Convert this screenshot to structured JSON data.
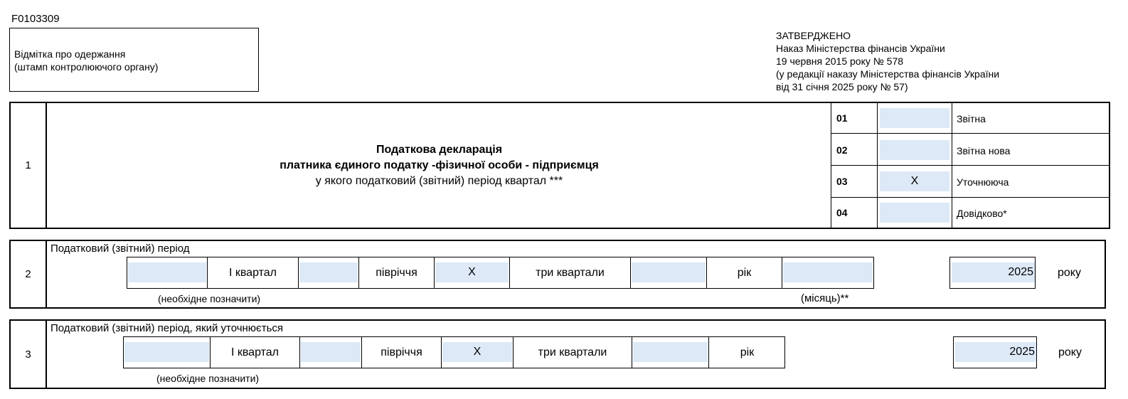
{
  "form_code": "F0103309",
  "stamp": {
    "line1": "Відмітка про одержання",
    "line2": "(штамп контролюючого органу)"
  },
  "approval": {
    "line1": "ЗАТВЕРДЖЕНО",
    "line2": "Наказ Міністерства фінансів України",
    "line3": "19 червня 2015 року № 578",
    "line4": "(у редакції наказу Міністерства фінансів України",
    "line5": "від 31 січня 2025 року № 57)"
  },
  "section1": {
    "number": "1",
    "title1": "Податкова декларація",
    "title2": "платника єдиного податку -фізичної особи - підприємця",
    "title3": "у якого податковий (звітний) період квартал ***",
    "types": [
      {
        "code": "01",
        "mark": "",
        "label": "Звітна"
      },
      {
        "code": "02",
        "mark": "",
        "label": "Звітна нова"
      },
      {
        "code": "03",
        "mark": "X",
        "label": "Уточнююча"
      },
      {
        "code": "04",
        "mark": "",
        "label": "Довідково*"
      }
    ]
  },
  "section2": {
    "number": "2",
    "heading": "Податковий (звітний) період",
    "q1_mark": "",
    "q1_label": "І квартал",
    "half_mark": "",
    "half_label": "півріччя",
    "three_q_mark": "X",
    "three_q_label": "три квартали",
    "year_mark": "",
    "year_label": "рік",
    "month_value": "",
    "year_value": "2025",
    "year_suffix": "року",
    "note_required": "(необхідне позначити)",
    "note_month": "(місяць)**"
  },
  "section3": {
    "number": "3",
    "heading": "Податковий (звітний) період, який уточнюється",
    "q1_mark": "",
    "q1_label": "І квартал",
    "half_mark": "",
    "half_label": "півріччя",
    "three_q_mark": "X",
    "three_q_label": "три квартали",
    "year_mark": "",
    "year_label": "рік",
    "year_value": "2025",
    "year_suffix": "року",
    "note_required": "(необхідне позначити)"
  }
}
